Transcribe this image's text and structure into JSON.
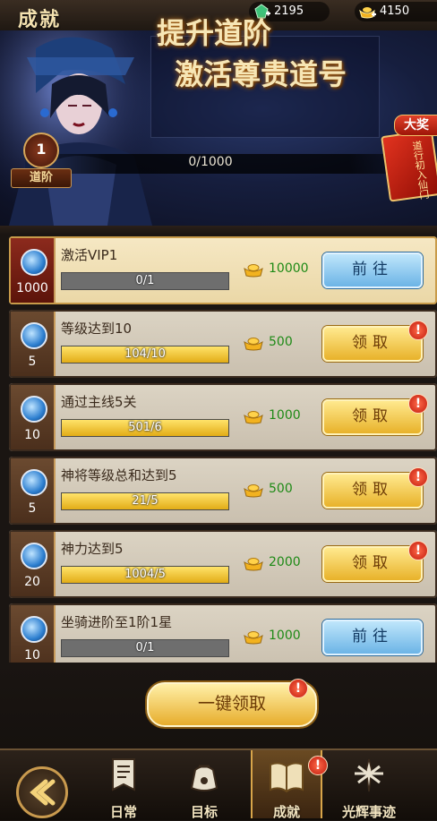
{
  "header": {
    "title": "成就",
    "currencies": [
      {
        "icon": "jade-icon",
        "value": "2195"
      },
      {
        "icon": "gold-ingot-icon",
        "value": "4150"
      }
    ]
  },
  "banner": {
    "slogan_line1": "提升道阶",
    "slogan_line2": "激活尊贵道号",
    "rank_level": "1",
    "rank_label": "道阶",
    "progress_text": "0/1000",
    "prize_label": "大奖",
    "prize_text": "道行初入仙门"
  },
  "tasks": [
    {
      "points": "1000",
      "name": "激活VIP1",
      "progress_text": "0/1",
      "progress": 0,
      "reward": "10000",
      "button": "前往",
      "button_type": "goto",
      "badge": false,
      "highlight": true
    },
    {
      "points": "5",
      "name": "等级达到10",
      "progress_text": "104/10",
      "progress": 1,
      "reward": "500",
      "button": "领取",
      "button_type": "claim",
      "badge": true,
      "highlight": false
    },
    {
      "points": "10",
      "name": "通过主线5关",
      "progress_text": "501/6",
      "progress": 1,
      "reward": "1000",
      "button": "领取",
      "button_type": "claim",
      "badge": true,
      "highlight": false
    },
    {
      "points": "5",
      "name": "神将等级总和达到5",
      "progress_text": "21/5",
      "progress": 1,
      "reward": "500",
      "button": "领取",
      "button_type": "claim",
      "badge": true,
      "highlight": false
    },
    {
      "points": "20",
      "name": "神力达到5",
      "progress_text": "1004/5",
      "progress": 1,
      "reward": "2000",
      "button": "领取",
      "button_type": "claim",
      "badge": true,
      "highlight": false
    },
    {
      "points": "10",
      "name": "坐骑进阶至1阶1星",
      "progress_text": "0/1",
      "progress": 0,
      "reward": "1000",
      "button": "前往",
      "button_type": "goto",
      "badge": false,
      "highlight": false
    }
  ],
  "footer": {
    "one_key_claim": "一键领取",
    "badge_symbol": "!",
    "nav": [
      {
        "label": "日常",
        "icon": "scroll-banner-icon",
        "active": false,
        "badge": false
      },
      {
        "label": "目标",
        "icon": "treasure-bag-icon",
        "active": false,
        "badge": false
      },
      {
        "label": "成就",
        "icon": "open-book-icon",
        "active": true,
        "badge": true
      },
      {
        "label": "光辉事迹",
        "icon": "radiant-deeds-icon",
        "active": false,
        "badge": false
      }
    ]
  }
}
